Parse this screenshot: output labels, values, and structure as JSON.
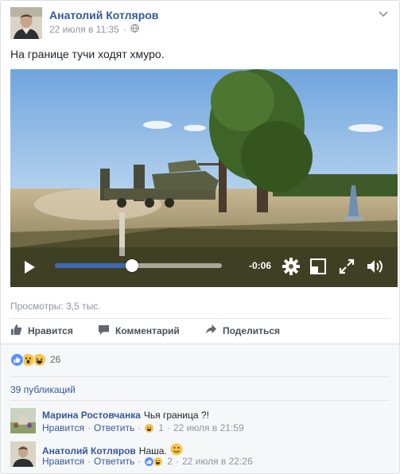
{
  "post": {
    "author": "Анатолий Котляров",
    "timestamp": "22 июля в 11:35",
    "separator": "·",
    "text": "На границе тучи ходят хмуро.",
    "menu_icon": "chevron-down-icon",
    "privacy_icon": "globe-icon"
  },
  "video": {
    "time_remaining": "-0:06",
    "progress_fraction": 0.46,
    "controls": [
      "play-icon",
      "settings-icon",
      "picture-in-picture-icon",
      "fullscreen-icon",
      "volume-icon"
    ]
  },
  "views": "Просмотры: 3,5 тыс.",
  "actions": {
    "like": "Нравится",
    "comment": "Комментарий",
    "share": "Поделиться"
  },
  "reactions": {
    "icons": [
      "like-reaction",
      "wow-reaction",
      "haha-reaction"
    ],
    "count": "26"
  },
  "publications": "39 публикаций",
  "comments": [
    {
      "author": "Марина Ростовчанка",
      "text": "Чья граница ?!",
      "like_label": "Нравится",
      "reply_label": "Ответить",
      "reaction_count": "1",
      "time": "22 июля в 21:59",
      "dot": "·"
    },
    {
      "author": "Анатолий Котляров",
      "text": "Наша.",
      "emoji": "smile-emoji",
      "like_label": "Нравится",
      "reply_label": "Ответить",
      "reaction_count": "2",
      "time": "22 июля в 22:26",
      "dot": "·"
    }
  ],
  "colors": {
    "link": "#365899",
    "accent": "#4267b2",
    "muted": "#90949c",
    "social_bg": "#f6f7f9"
  }
}
